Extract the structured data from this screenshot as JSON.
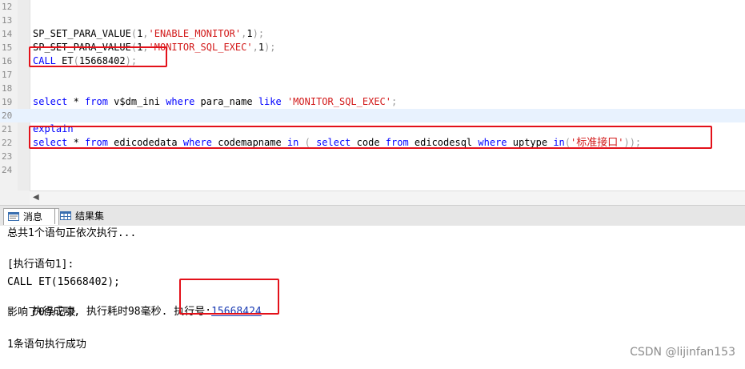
{
  "editor": {
    "lines": [
      {
        "num": "12",
        "tokens": []
      },
      {
        "num": "13",
        "tokens": []
      },
      {
        "num": "14",
        "tokens": [
          {
            "t": "SP_SET_PARA_VALUE",
            "c": "plain"
          },
          {
            "t": "(",
            "c": "dim"
          },
          {
            "t": "1",
            "c": "plain"
          },
          {
            "t": ",",
            "c": "dim"
          },
          {
            "t": "'ENABLE_MONITOR'",
            "c": "str"
          },
          {
            "t": ",",
            "c": "dim"
          },
          {
            "t": "1",
            "c": "plain"
          },
          {
            "t": ");",
            "c": "dim"
          }
        ]
      },
      {
        "num": "15",
        "tokens": [
          {
            "t": "SP_SET_PARA_VALUE",
            "c": "plain"
          },
          {
            "t": "(",
            "c": "dim"
          },
          {
            "t": "1",
            "c": "plain"
          },
          {
            "t": ",",
            "c": "dim"
          },
          {
            "t": "'MONITOR_SQL_EXEC'",
            "c": "str"
          },
          {
            "t": ",",
            "c": "dim"
          },
          {
            "t": "1",
            "c": "plain"
          },
          {
            "t": ");",
            "c": "dim"
          }
        ]
      },
      {
        "num": "16",
        "tokens": [
          {
            "t": "CALL",
            "c": "kw"
          },
          {
            "t": " ET",
            "c": "plain"
          },
          {
            "t": "(",
            "c": "dim"
          },
          {
            "t": "15668402",
            "c": "plain"
          },
          {
            "t": ");",
            "c": "dim"
          }
        ]
      },
      {
        "num": "17",
        "tokens": []
      },
      {
        "num": "18",
        "tokens": []
      },
      {
        "num": "19",
        "tokens": [
          {
            "t": "select",
            "c": "kw"
          },
          {
            "t": " * ",
            "c": "plain"
          },
          {
            "t": "from",
            "c": "kw"
          },
          {
            "t": " v$dm_ini ",
            "c": "plain"
          },
          {
            "t": "where",
            "c": "kw"
          },
          {
            "t": " para_name ",
            "c": "plain"
          },
          {
            "t": "like",
            "c": "kw"
          },
          {
            "t": " ",
            "c": "plain"
          },
          {
            "t": "'MONITOR_SQL_EXEC'",
            "c": "str"
          },
          {
            "t": ";",
            "c": "dim"
          }
        ]
      },
      {
        "num": "20",
        "tokens": [],
        "current": true
      },
      {
        "num": "21",
        "tokens": [
          {
            "t": "explain",
            "c": "kw"
          }
        ]
      },
      {
        "num": "22",
        "tokens": [
          {
            "t": "select",
            "c": "kw"
          },
          {
            "t": " * ",
            "c": "plain"
          },
          {
            "t": "from",
            "c": "kw"
          },
          {
            "t": " edicodedata ",
            "c": "plain"
          },
          {
            "t": "where",
            "c": "kw"
          },
          {
            "t": " codemapname ",
            "c": "plain"
          },
          {
            "t": "in",
            "c": "kw"
          },
          {
            "t": " ( ",
            "c": "dim"
          },
          {
            "t": "select",
            "c": "kw"
          },
          {
            "t": " code ",
            "c": "plain"
          },
          {
            "t": "from",
            "c": "kw"
          },
          {
            "t": " edicodesql ",
            "c": "plain"
          },
          {
            "t": "where",
            "c": "kw"
          },
          {
            "t": " uptype ",
            "c": "plain"
          },
          {
            "t": "in",
            "c": "kw"
          },
          {
            "t": "(",
            "c": "dim"
          },
          {
            "t": "'",
            "c": "str"
          },
          {
            "t": "标准接口",
            "c": "str",
            "cjk": true
          },
          {
            "t": "'",
            "c": "str"
          },
          {
            "t": "));",
            "c": "dim"
          }
        ]
      },
      {
        "num": "23",
        "tokens": []
      },
      {
        "num": "24",
        "tokens": []
      }
    ]
  },
  "tabs": {
    "messages": "消息",
    "results": "结果集"
  },
  "output": {
    "line1": "总共1个语句正依次执行...",
    "line2": "[执行语句1]:",
    "line3": "CALL ET(15668402);",
    "line4_prefix": "执行成功, 执行耗时98毫秒. 执行号:",
    "line4_exec_no": "15668424",
    "line5": "影响了0条记录",
    "line6": "1条语句执行成功"
  },
  "watermark": "CSDN @lijinfan153",
  "colors": {
    "keyword": "#0000ff",
    "string": "#d21a1a",
    "annotation": "#e3111a",
    "link": "#1a3bb3"
  },
  "icons": {
    "messages_tab": "message-icon",
    "results_tab": "grid-icon",
    "scroll_left": "chevron-left-icon"
  }
}
